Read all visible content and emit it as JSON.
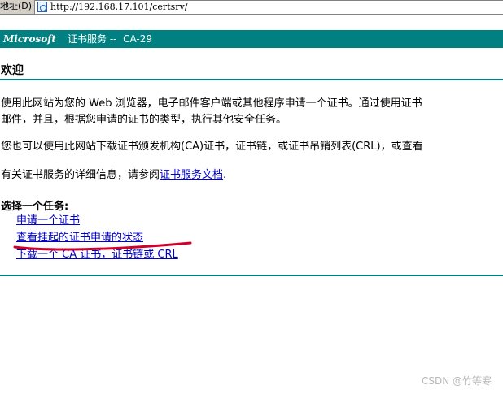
{
  "address_bar": {
    "label": "地址(D)",
    "url": "http://192.168.17.101/certsrv/",
    "icon": "ie-page-icon"
  },
  "banner": {
    "brand": "Microsoft",
    "title": "证书服务 --  CA-29",
    "color": "#008080"
  },
  "welcome": {
    "heading": "欢迎",
    "paragraph1_line1": "使用此网站为您的 Web 浏览器，电子邮件客户端或其他程序申请一个证书。通过使用证书",
    "paragraph1_line2": "邮件，并且，根据您申请的证书的类型，执行其他安全任务。",
    "paragraph2": "您也可以使用此网站下载证书颁发机构(CA)证书，证书链，或证书吊销列表(CRL)，或查看",
    "paragraph3_prefix": "有关证书服务的详细信息，请参阅",
    "paragraph3_link": "证书服务文档",
    "paragraph3_suffix": "."
  },
  "tasks": {
    "title": "选择一个任务:",
    "items": [
      {
        "label": "申请一个证书"
      },
      {
        "label": "查看挂起的证书申请的状态"
      },
      {
        "label": "下载一个 CA 证书，证书链或 CRL"
      }
    ]
  },
  "annotation_color": "#d0002a",
  "watermark": "CSDN @竹等寒"
}
